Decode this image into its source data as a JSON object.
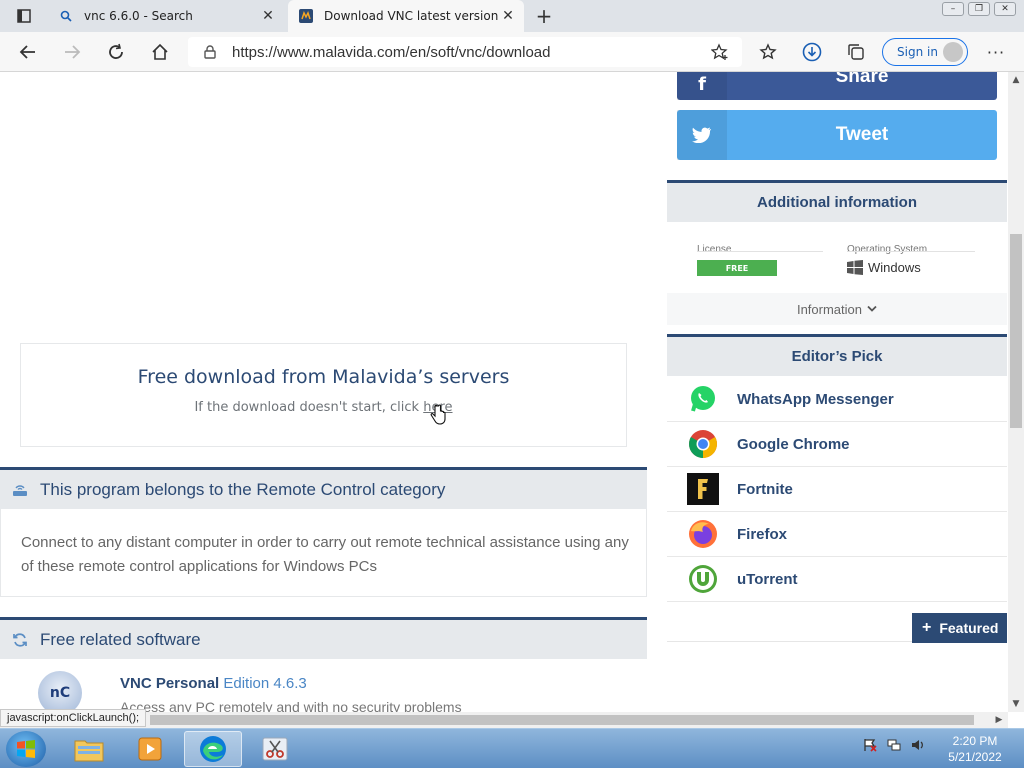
{
  "browser": {
    "tabs": [
      {
        "title": "vnc 6.6.0 - Search",
        "active": false
      },
      {
        "title": "Download VNC latest version in",
        "active": true
      }
    ],
    "url": "https://www.malavida.com/en/soft/vnc/download",
    "signin_label": "Sign in"
  },
  "download": {
    "title": "Free download from Malavida’s servers",
    "subtitle_prefix": "If the download doesn't start, click ",
    "subtitle_link": "here"
  },
  "category": {
    "heading": "This program belongs to the Remote Control category",
    "description": "Connect to any distant computer in order to carry out remote technical assistance using any of these remote control applications for Windows PCs"
  },
  "related": {
    "heading": "Free related software",
    "items": [
      {
        "logo": "nC",
        "name": "VNC Personal",
        "version": "Edition 4.6.3",
        "description": "Access any PC remotely and with no security problems"
      }
    ]
  },
  "social": {
    "share_label": "Share",
    "tweet_label": "Tweet",
    "share_color": "#3b5998",
    "tweet_color": "#55acee"
  },
  "additional_info": {
    "heading": "Additional information",
    "license_label": "License",
    "license_value": "FREE",
    "os_label": "Operating System",
    "os_value": "Windows",
    "more_label": "Information"
  },
  "editors_pick": {
    "heading": "Editor’s Pick",
    "items": [
      {
        "name": "WhatsApp Messenger",
        "icon": "whatsapp-icon"
      },
      {
        "name": "Google Chrome",
        "icon": "chrome-icon"
      },
      {
        "name": "Fortnite",
        "icon": "fortnite-icon"
      },
      {
        "name": "Firefox",
        "icon": "firefox-icon"
      },
      {
        "name": "uTorrent",
        "icon": "utorrent-icon"
      }
    ],
    "featured_label": "Featured"
  },
  "status_bar_text": "javascript:onClickLaunch();",
  "taskbar": {
    "time": "2:20 PM",
    "date": "5/21/2022"
  },
  "colors": {
    "accent": "#2c4a74",
    "free_badge": "#4caf50"
  }
}
